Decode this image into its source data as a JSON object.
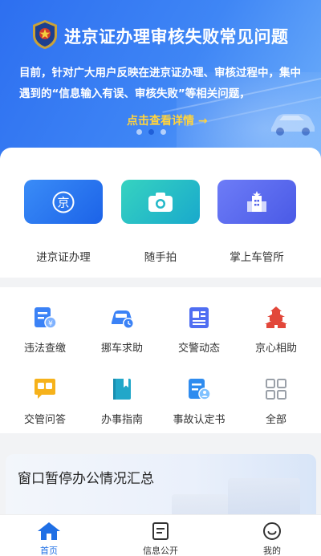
{
  "banner": {
    "title": "进京证办理审核失败常见问题",
    "description": "目前，针对广大用户反映在进京证办理、审核过程中，集中遇到的“信息输入有误、审核失败”等相关问题，",
    "link": "点击查看详情 →"
  },
  "primary": [
    {
      "label": "进京证办理",
      "icon": "jing-seal-icon"
    },
    {
      "label": "随手拍",
      "icon": "camera-icon"
    },
    {
      "label": "掌上车管所",
      "icon": "police-building-icon"
    }
  ],
  "services": [
    {
      "label": "违法查缴",
      "icon": "fine-payment-icon"
    },
    {
      "label": "挪车求助",
      "icon": "car-move-icon"
    },
    {
      "label": "交警动态",
      "icon": "news-icon"
    },
    {
      "label": "京心相助",
      "icon": "temple-icon"
    },
    {
      "label": "交管问答",
      "icon": "qa-chat-icon"
    },
    {
      "label": "办事指南",
      "icon": "guide-book-icon"
    },
    {
      "label": "事故认定书",
      "icon": "accident-doc-icon"
    },
    {
      "label": "全部",
      "icon": "all-grid-icon"
    }
  ],
  "notice": {
    "title": "窗口暂停办公情况汇总"
  },
  "tabs": [
    {
      "label": "首页",
      "icon": "home-icon",
      "active": true
    },
    {
      "label": "信息公开",
      "icon": "document-icon",
      "active": false
    },
    {
      "label": "我的",
      "icon": "smile-icon",
      "active": false
    }
  ],
  "colors": {
    "accent": "#1f6fe5",
    "highlight": "#ffd33d",
    "bannerBlue": "#2d6ff0"
  }
}
